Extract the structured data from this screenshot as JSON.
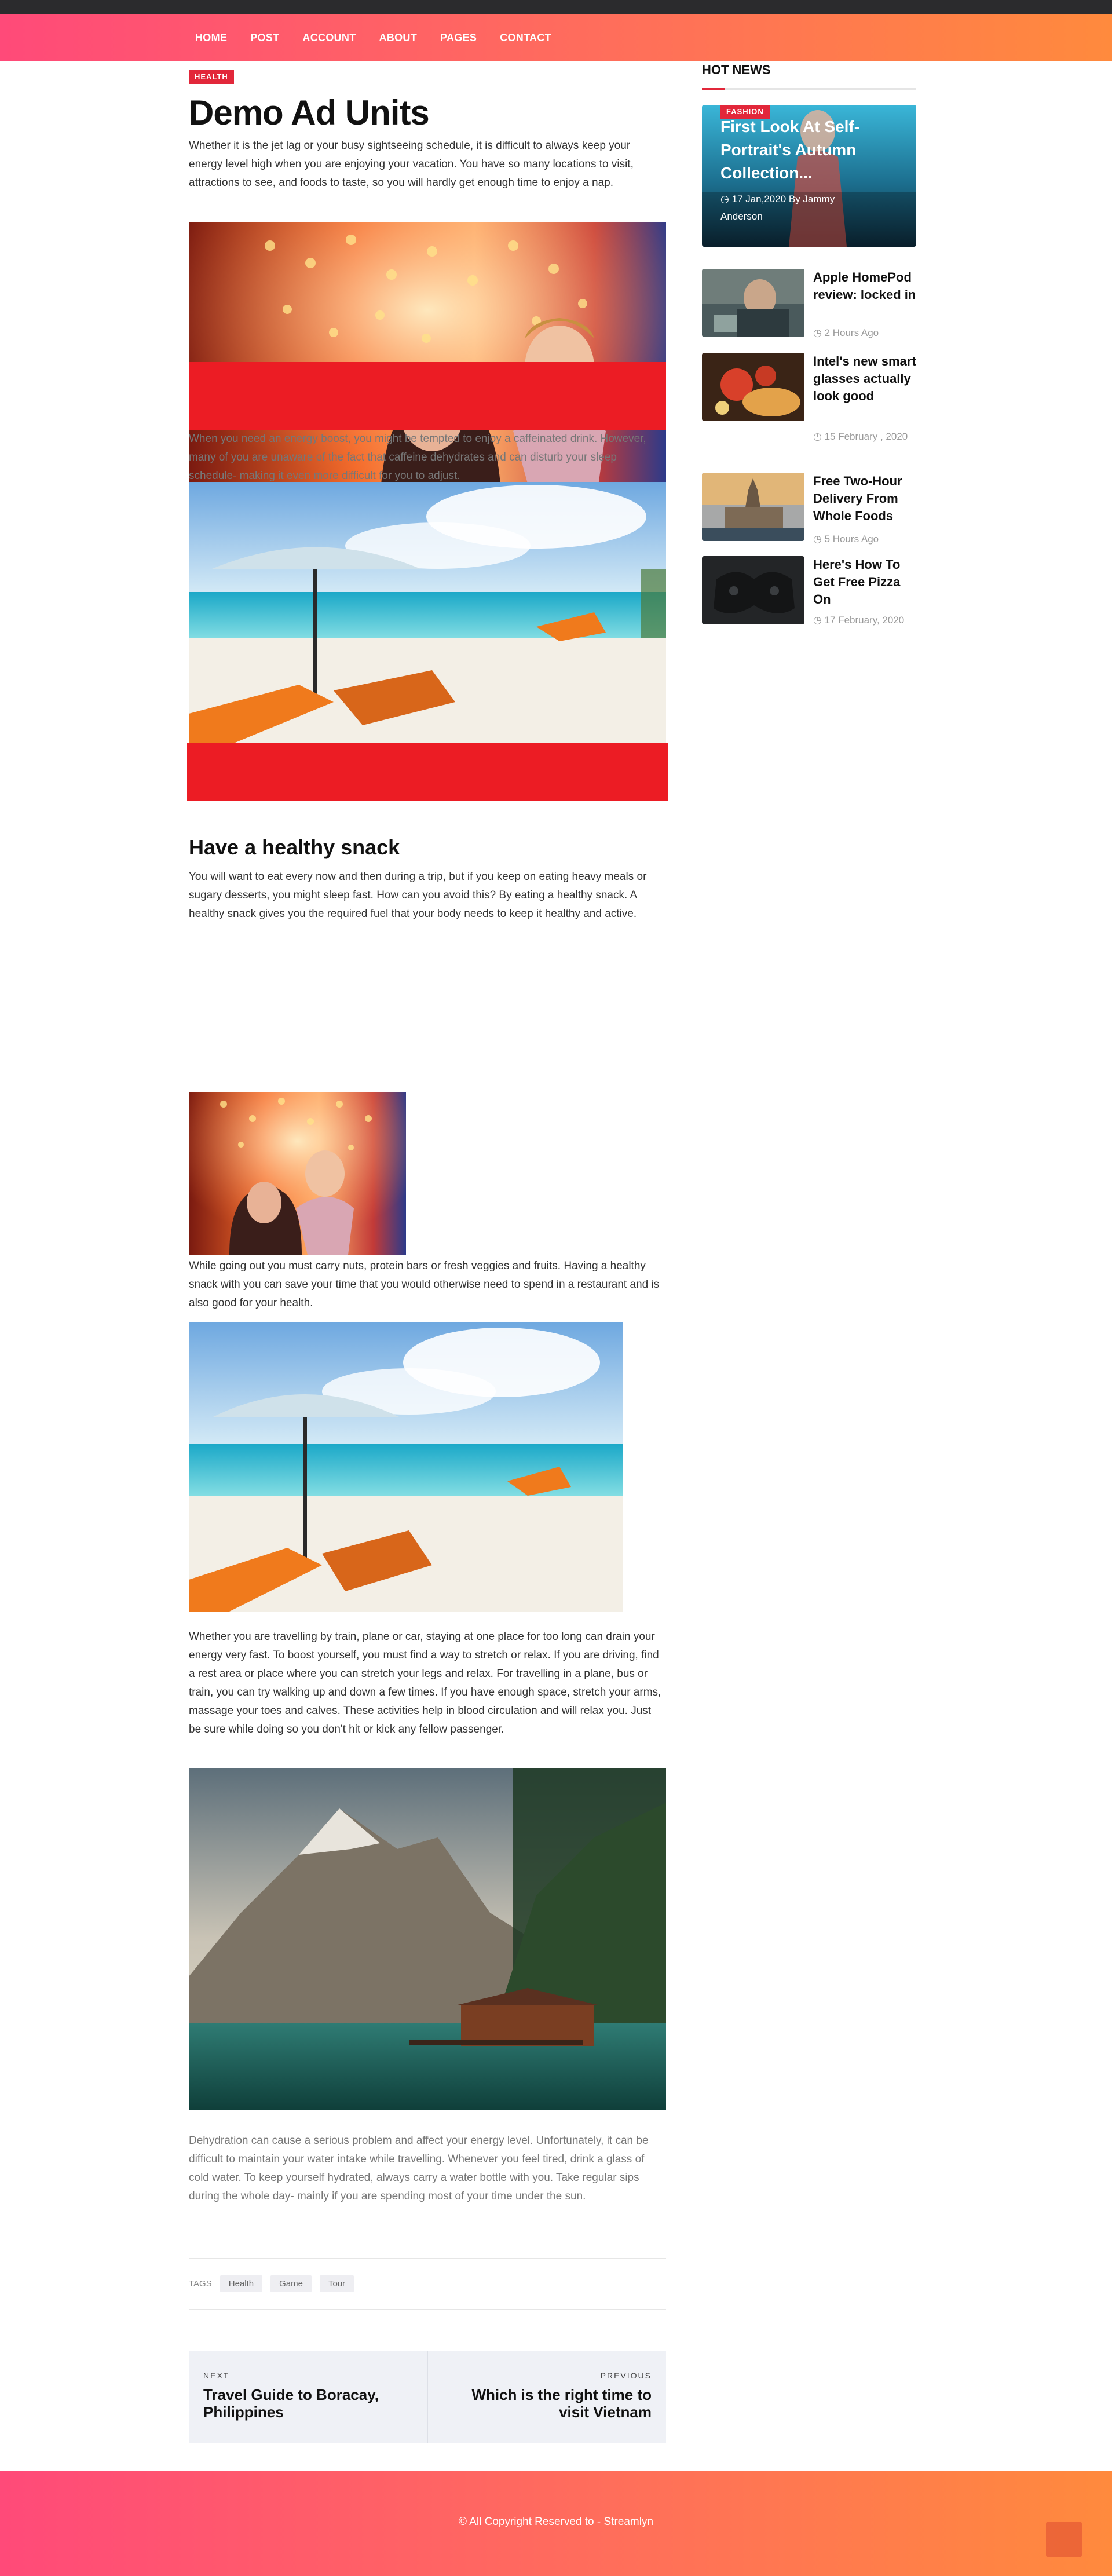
{
  "nav": {
    "items": [
      "HOME",
      "POST",
      "ACCOUNT",
      "ABOUT",
      "PAGES",
      "CONTACT"
    ]
  },
  "article": {
    "category": "HEALTH",
    "title": "Demo Ad Units",
    "intro": "Whether it is the jet lag or your busy sightseeing schedule, it is difficult to always keep your energy level high when you are enjoying your vacation. You have so many locations to visit, attractions to see, and foods to taste, so you will hardly get enough time to enjoy a nap.",
    "para2": "When you need an energy boost, you might be tempted to enjoy a caffeinated drink. However, many of you are unaware of the fact that caffeine dehydrates and can disturb your sleep schedule- making it even more difficult for you to adjust.",
    "section_title": "Have a healthy snack",
    "para3": "You will want to eat every now and then during a trip, but if you keep on eating heavy meals or sugary desserts, you might sleep fast. How can you avoid this? By eating a healthy snack. A healthy snack gives you the required fuel that your body needs to keep it healthy and active.",
    "para4": "While going out you must carry nuts, protein bars or fresh veggies and fruits. Having a healthy snack with you can save your time that you would otherwise need to spend in a restaurant and is also good for your health.",
    "para5": "Whether you are travelling by train, plane or car, staying at one place for too long can drain your energy very fast. To boost yourself, you must find a way to stretch or relax. If you are driving, find a rest area or place where you can stretch your legs and relax. For travelling in a plane, bus or train, you can try walking up and down a few times. If you have enough space, stretch your arms, massage your toes and calves. These activities help in blood circulation and will relax you. Just be sure while doing so you don't hit or kick any fellow passenger.",
    "para6": "Dehydration can cause a serious problem and affect your energy level. Unfortunately, it can be difficult to maintain your water intake while travelling. Whenever you feel tired, drink a glass of cold water. To keep yourself hydrated, always carry a water bottle with you. Take regular sips during the whole day- mainly if you are spending most of your time under the sun.",
    "tags_label": "TAGS",
    "tags": [
      "Health",
      "Game",
      "Tour"
    ]
  },
  "postnav": {
    "next_label": "NEXT",
    "next_title": "Travel Guide to Boracay, Philippines",
    "prev_label": "PREVIOUS",
    "prev_title": "Which is the right time to visit Vietnam"
  },
  "sidebar": {
    "heading": "HOT NEWS",
    "feature": {
      "category": "FASHION",
      "title": "First Look At Self-Portrait's Autumn Collection...",
      "meta": "17 Jan,2020   By Jammy Anderson"
    },
    "items": [
      {
        "title": "Apple HomePod review: locked in",
        "time": "2 Hours Ago"
      },
      {
        "title": "Intel's new smart glasses actually look good",
        "time": "15 February , 2020"
      },
      {
        "title": "Free Two-Hour Delivery From Whole Foods",
        "time": "5 Hours Ago"
      },
      {
        "title": "Here's How To Get Free Pizza On",
        "time": "17 February, 2020"
      }
    ]
  },
  "footer": {
    "copyright": "© All Copyright Reserved to - Streamlyn"
  },
  "colors": {
    "accent_red": "#e2273a",
    "ad_red": "#ec1c24",
    "gradient_start": "#ff4a79",
    "gradient_end": "#ff8a3d"
  }
}
